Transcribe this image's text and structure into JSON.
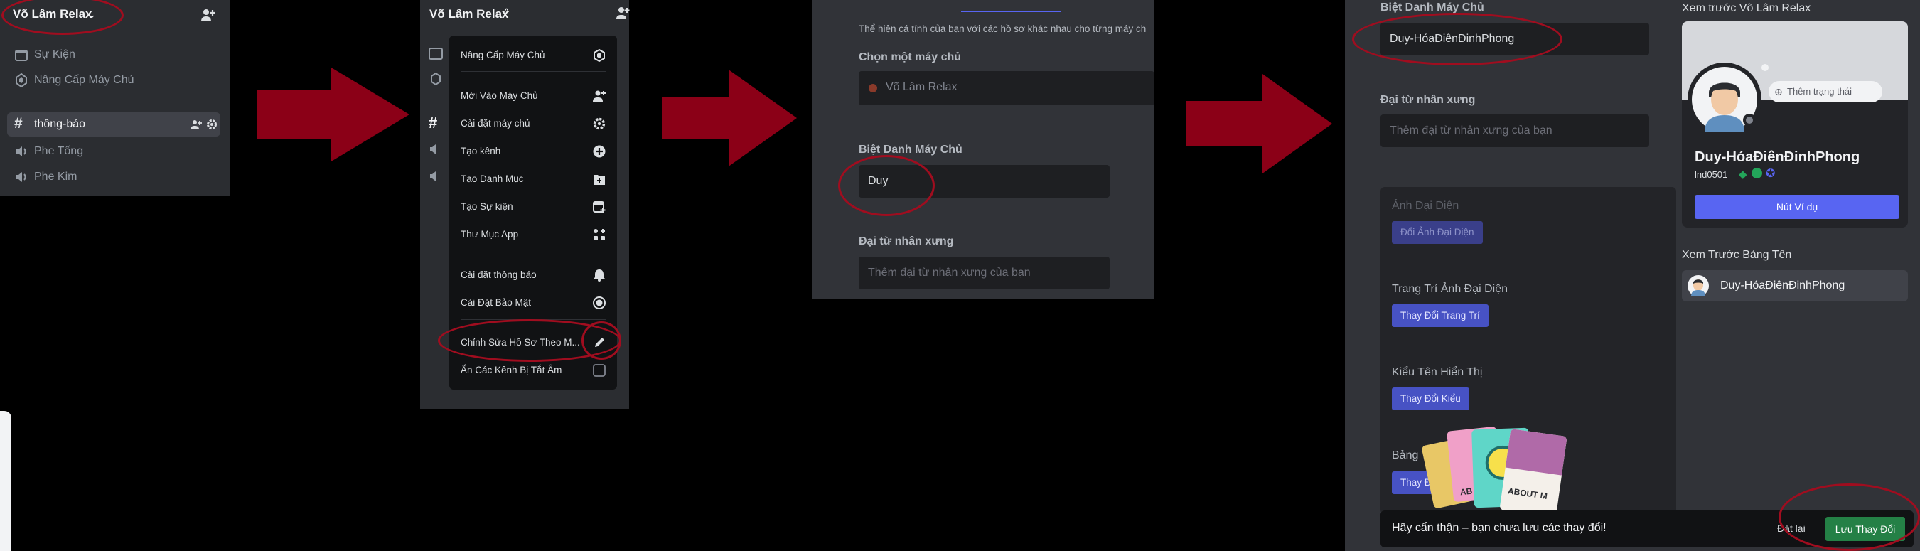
{
  "colors": {
    "sidebar_bg": "#2b2d31",
    "menu_bg": "#111214",
    "content_bg": "#313338",
    "input_bg": "#1e1f22",
    "accent": "#5865f2",
    "save_green": "#248046",
    "arrow_red": "#8b0017",
    "highlight_ring": "#a00d1f"
  },
  "panel1": {
    "server_name": "Võ Lâm Relax",
    "chevron": "⌄",
    "items": [
      {
        "label": "Sự Kiện",
        "icon": "calendar-icon"
      },
      {
        "label": "Nâng Cấp Máy Chủ",
        "icon": "boost-icon"
      },
      {
        "label": "thông-báo",
        "icon": "hash-icon",
        "active": true
      },
      {
        "label": "Phe Tống",
        "icon": "speaker-icon"
      },
      {
        "label": "Phe Kim",
        "icon": "speaker-icon"
      }
    ]
  },
  "panel2": {
    "server_name": "Võ Lâm Relax",
    "caret": "^",
    "menu": [
      {
        "label": "Nâng Cấp Máy Chủ",
        "icon": "boost-icon"
      },
      {
        "label": "Mời Vào Máy Chủ",
        "icon": "add-person-icon"
      },
      {
        "label": "Cài đặt máy chủ",
        "icon": "gear-icon"
      },
      {
        "label": "Tạo kênh",
        "icon": "plus-circle-icon"
      },
      {
        "label": "Tạo Danh Mục",
        "icon": "folder-plus-icon"
      },
      {
        "label": "Tạo Sự kiện",
        "icon": "calendar-plus-icon"
      },
      {
        "label": "Thư Mục App",
        "icon": "apps-icon"
      },
      {
        "label": "Cài đặt thông báo",
        "icon": "bell-icon"
      },
      {
        "label": "Cài Đặt Bảo Mật",
        "icon": "shield-icon"
      },
      {
        "label": "Chỉnh Sửa Hồ Sơ Theo M...",
        "icon": "pencil-icon"
      },
      {
        "label": "Ẩn Các Kênh Bị Tắt Âm",
        "icon": "checkbox-icon"
      }
    ]
  },
  "panel3": {
    "description": "Thể hiện cá tính của bạn với các hồ sơ khác nhau cho từng máy ch",
    "choose_server_title": "Chọn một máy chủ",
    "selected_server": "Võ Lâm Relax",
    "nickname_title": "Biệt Danh Máy Chủ",
    "nickname_value": "Duy",
    "pronouns_title": "Đại từ nhân xưng",
    "pronouns_placeholder": "Thêm đại từ nhân xưng của bạn"
  },
  "panel4": {
    "nickname_title": "Biệt Danh Máy Chủ",
    "nickname_value": "Duy-HóaĐiênĐinhPhong",
    "pronouns_title": "Đại từ nhân xưng",
    "pronouns_placeholder": "Thêm đại từ nhân xưng của bạn",
    "avatar_title": "Ảnh Đại Diện",
    "avatar_button": "Đổi Ảnh Đại Diện",
    "decoration_title": "Trang Trí Ảnh Đại Diện",
    "decoration_button": "Thay Đổi Trang Trí",
    "display_style_title": "Kiểu Tên Hiển Thị",
    "display_style_button": "Thay Đổi Kiểu",
    "nameplate_title_partial": "Bảng T",
    "nameplate_button_partial": "Thay Đ",
    "about_me_card_text": "ABOUT M",
    "ab_text": "AB",
    "preview_title": "Xem trước Võ Lâm Relax",
    "add_status": "Thêm trạng thái",
    "display_name": "Duy-HóaĐiênĐinhPhong",
    "username": "lnd0501",
    "example_button": "Nút Ví dụ",
    "nameplate_preview_title": "Xem Trước Bảng Tên",
    "nameplate_name": "Duy-HóaĐiênĐinhPhong",
    "save_bar_message": "Hãy cẩn thận – bạn chưa lưu các thay đổi!",
    "reset_label": "Đặt lại",
    "save_label": "Lưu Thay Đổi"
  }
}
